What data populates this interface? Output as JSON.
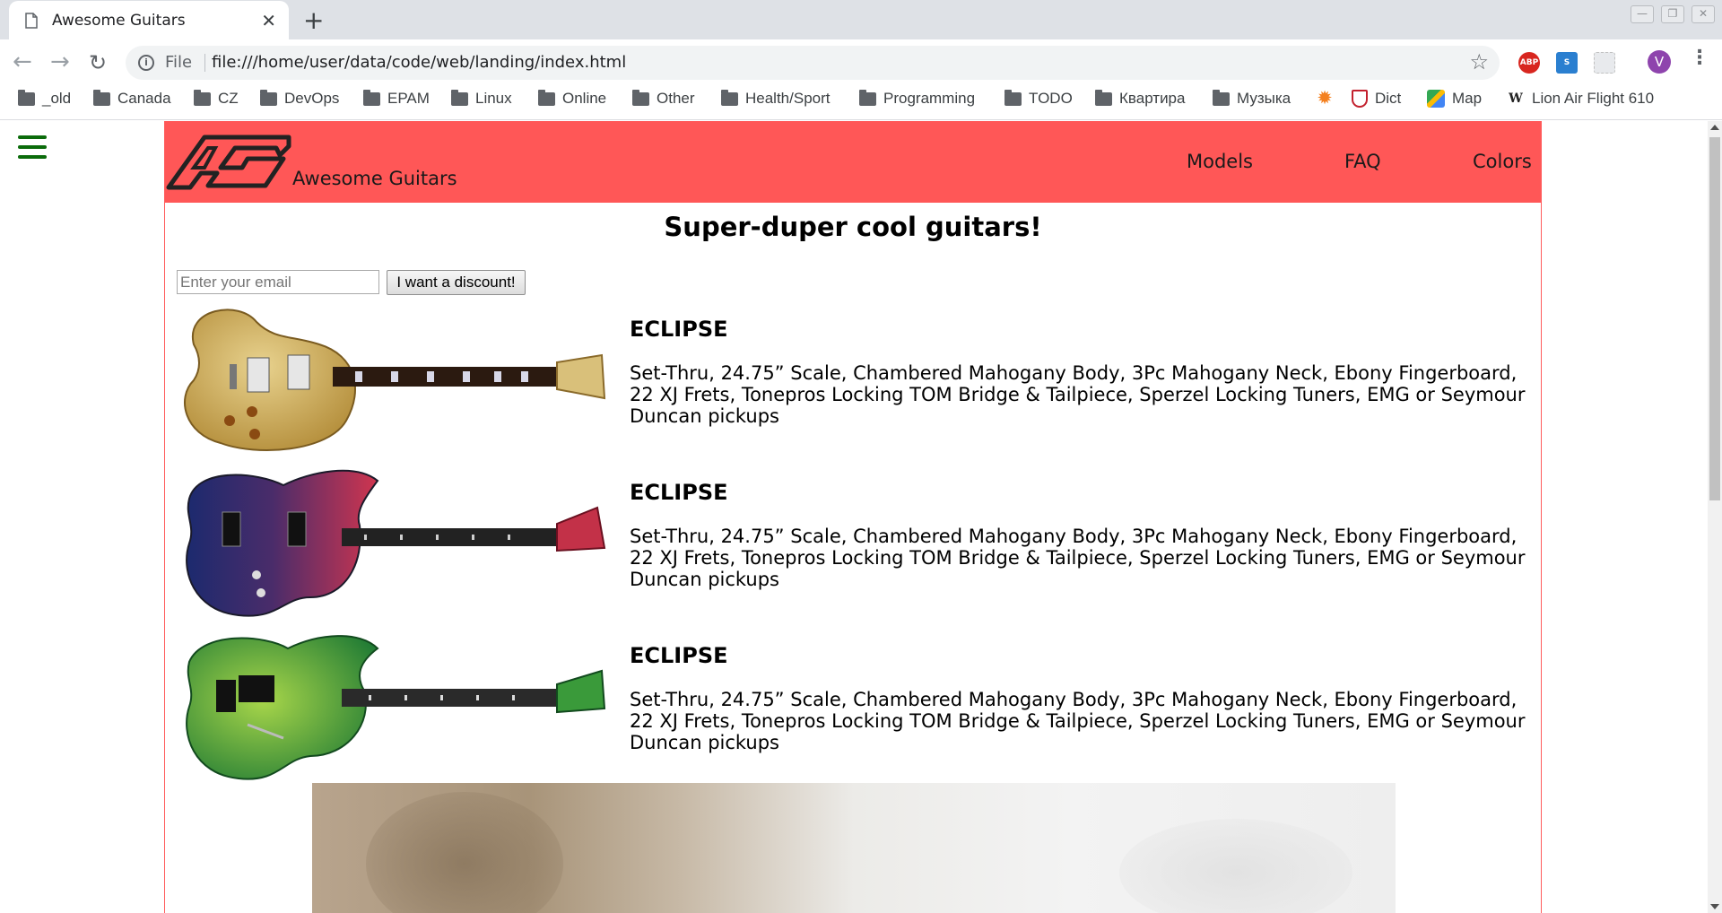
{
  "browser": {
    "tab": {
      "title": "Awesome Guitars",
      "close_glyph": "✕",
      "icon": "page-icon"
    },
    "new_tab_glyph": "+",
    "window_controls": [
      "minimize-icon",
      "restore-icon",
      "close-icon"
    ],
    "nav": {
      "back_glyph": "←",
      "forward_glyph": "→",
      "reload_glyph": "↻"
    },
    "omnibox": {
      "scheme_label": "File",
      "url": "file:///home/user/data/code/web/landing/index.html",
      "star_glyph": "☆"
    },
    "extensions": [
      {
        "name": "adblock-plus-icon",
        "label": "ABP",
        "color": "#d8261f"
      },
      {
        "name": "extension-s-icon",
        "label": "S",
        "color": "#2a7fd0"
      },
      {
        "name": "extension-blank-icon",
        "label": "",
        "color": "#e8eaed"
      }
    ],
    "profile_initial": "V",
    "menu_glyph": "⋮",
    "bookmarks": [
      {
        "label": "_old",
        "icon": "folder-icon"
      },
      {
        "label": "Canada",
        "icon": "folder-icon"
      },
      {
        "label": "CZ",
        "icon": "folder-icon"
      },
      {
        "label": "DevOps",
        "icon": "folder-icon"
      },
      {
        "label": "EPAM",
        "icon": "folder-icon"
      },
      {
        "label": "Linux",
        "icon": "folder-icon"
      },
      {
        "label": "Online",
        "icon": "folder-icon"
      },
      {
        "label": "Other",
        "icon": "folder-icon"
      },
      {
        "label": "Health/Sport",
        "icon": "folder-icon"
      },
      {
        "label": "Programming",
        "icon": "folder-icon"
      },
      {
        "label": "TODO",
        "icon": "folder-icon"
      },
      {
        "label": "Квартира",
        "icon": "folder-icon"
      },
      {
        "label": "Музыка",
        "icon": "folder-icon"
      },
      {
        "label": "",
        "icon": "sun-icon"
      },
      {
        "label": "Dict",
        "icon": "shield-crest-icon"
      },
      {
        "label": "Map",
        "icon": "google-maps-icon"
      },
      {
        "label": "Lion Air Flight 610",
        "icon": "wikipedia-icon"
      }
    ]
  },
  "site": {
    "accent_color": "#ff5757",
    "brand": "Awesome Guitars",
    "logo_text": "AG",
    "nav": [
      "Models",
      "FAQ",
      "Colors"
    ],
    "headline": "Super-duper cool guitars!",
    "signup": {
      "placeholder": "Enter your email",
      "button_label": "I want a discount!"
    },
    "products": [
      {
        "name": "ECLIPSE",
        "finish": "gold-quilt",
        "description": "Set-Thru, 24.75” Scale, Chambered Mahogany Body, 3Pc Mahogany Neck, Ebony Fingerboard, 22 XJ Frets, Tonepros Locking TOM Bridge & Tailpiece, Sperzel Locking Tuners, EMG or Seymour Duncan pickups"
      },
      {
        "name": "ECLIPSE",
        "finish": "blue-red-burst",
        "description": "Set-Thru, 24.75” Scale, Chambered Mahogany Body, 3Pc Mahogany Neck, Ebony Fingerboard, 22 XJ Frets, Tonepros Locking TOM Bridge & Tailpiece, Sperzel Locking Tuners, EMG or Seymour Duncan pickups"
      },
      {
        "name": "ECLIPSE",
        "finish": "green-flame",
        "description": "Set-Thru, 24.75” Scale, Chambered Mahogany Body, 3Pc Mahogany Neck, Ebony Fingerboard, 22 XJ Frets, Tonepros Locking TOM Bridge & Tailpiece, Sperzel Locking Tuners, EMG or Seymour Duncan pickups"
      }
    ]
  }
}
